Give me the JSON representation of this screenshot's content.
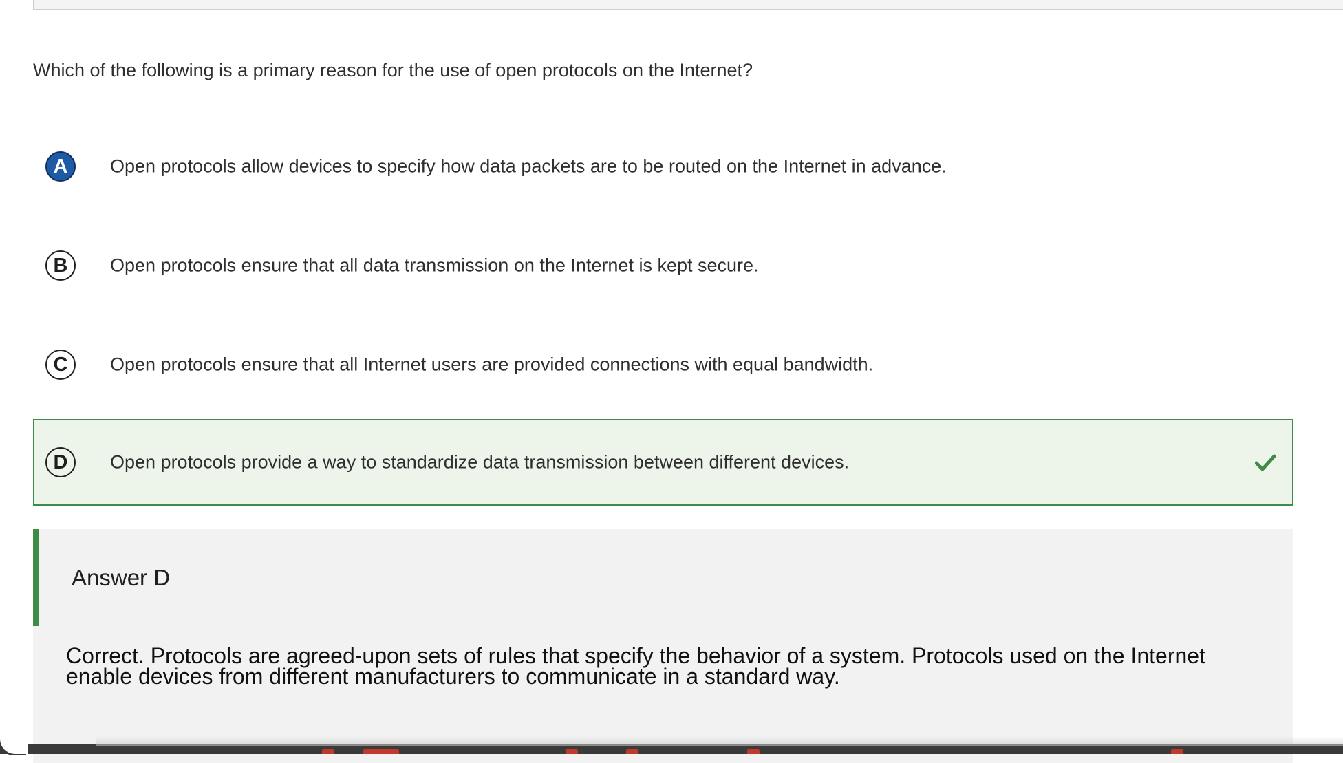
{
  "question": {
    "text": "Which of the following is a primary reason for the use of open protocols on the Internet?"
  },
  "options": [
    {
      "letter": "A",
      "text": "Open protocols allow devices to specify how data packets are to be routed on the Internet in advance.",
      "state": "selected"
    },
    {
      "letter": "B",
      "text": "Open protocols ensure that all data transmission on the Internet is kept secure.",
      "state": "default"
    },
    {
      "letter": "C",
      "text": "Open protocols ensure that all Internet users are provided connections with equal bandwidth.",
      "state": "default"
    },
    {
      "letter": "D",
      "text": "Open protocols provide a way to standardize data transmission between different devices.",
      "state": "correct",
      "icon": "checkmark-icon"
    }
  ],
  "feedback": {
    "answer_label": "Answer D",
    "explanation": "Correct. Protocols are agreed-upon sets of rules that specify the behavior of a system. Protocols used on the Internet enable devices from different manufacturers to communicate in a standard way."
  },
  "colors": {
    "selected_fill": "#1c5aa6",
    "correct_border": "#3e8c47",
    "correct_background": "#edf4ea",
    "feedback_background": "#f2f2f2"
  }
}
